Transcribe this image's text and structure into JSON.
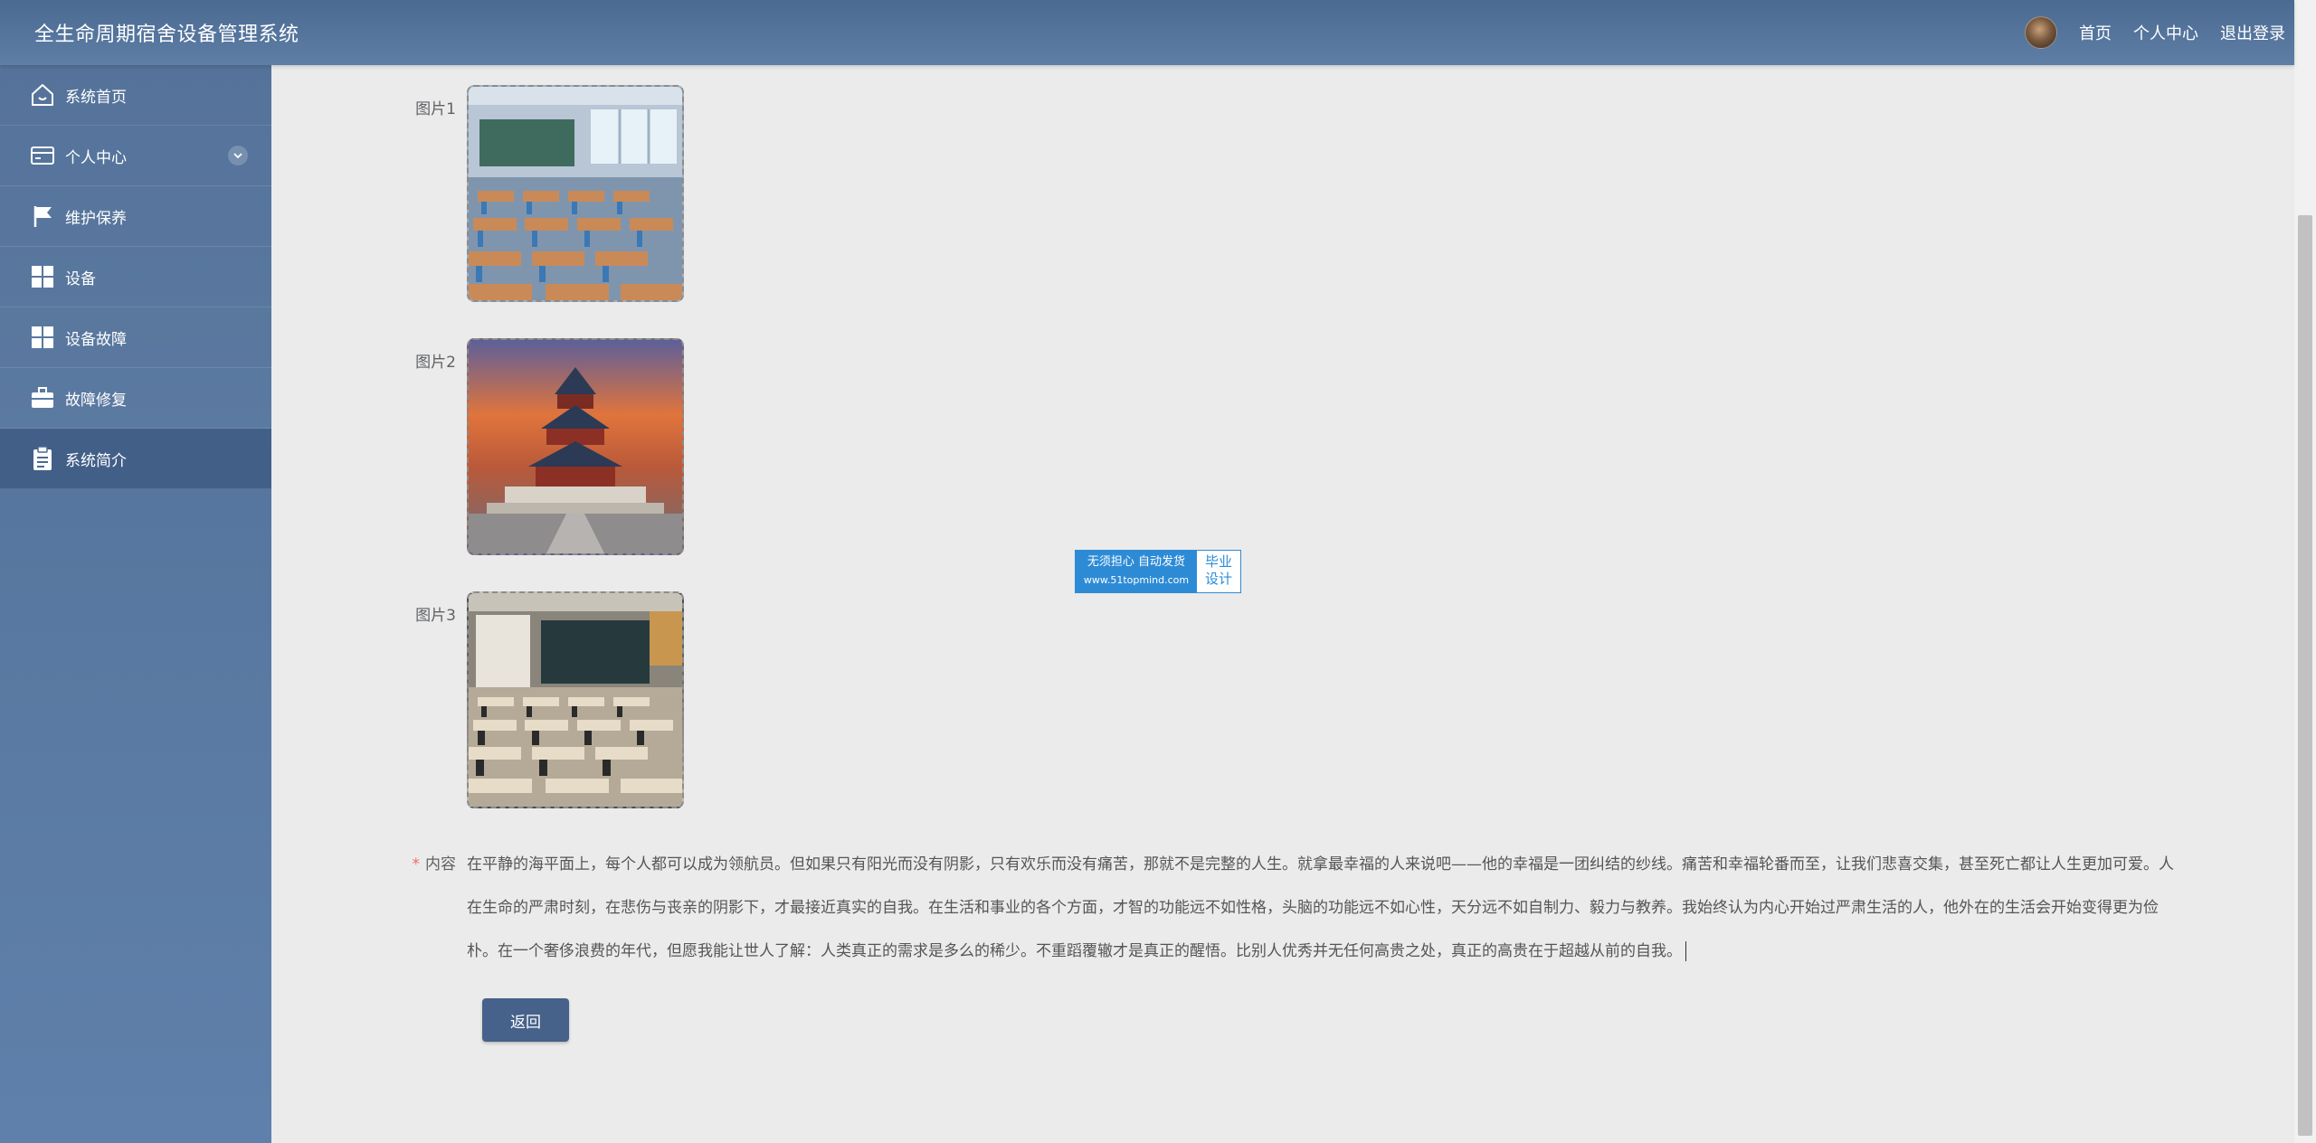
{
  "app": {
    "title": "全生命周期宿舍设备管理系统"
  },
  "header": {
    "links": {
      "home": "首页",
      "profile": "个人中心",
      "logout": "退出登录"
    }
  },
  "sidebar": {
    "items": [
      {
        "label": "系统首页",
        "icon": "home-icon"
      },
      {
        "label": "个人中心",
        "icon": "card-icon"
      },
      {
        "label": "维护保养",
        "icon": "flag-icon"
      },
      {
        "label": "设备",
        "icon": "grid-icon"
      },
      {
        "label": "设备故障",
        "icon": "grid-icon"
      },
      {
        "label": "故障修复",
        "icon": "briefcase-icon"
      },
      {
        "label": "系统简介",
        "icon": "clipboard-icon"
      }
    ]
  },
  "form": {
    "pic1_label": "图片1",
    "pic2_label": "图片2",
    "pic3_label": "图片3",
    "content_required": "*",
    "content_label": "内容",
    "content_text": "在平静的海平面上，每个人都可以成为领航员。但如果只有阳光而没有阴影，只有欢乐而没有痛苦，那就不是完整的人生。就拿最幸福的人来说吧——他的幸福是一团纠结的纱线。痛苦和幸福轮番而至，让我们悲喜交集，甚至死亡都让人生更加可爱。人在生命的严肃时刻，在悲伤与丧亲的阴影下，才最接近真实的自我。在生活和事业的各个方面，才智的功能远不如性格，头脑的功能远不如心性，天分远不如自制力、毅力与教养。我始终认为内心开始过严肃生活的人，他外在的生活会开始变得更为俭朴。在一个奢侈浪费的年代，但愿我能让世人了解：人类真正的需求是多么的稀少。不重蹈覆辙才是真正的醒悟。比别人优秀并无任何高贵之处，真正的高贵在于超越从前的自我。",
    "back_button": "返回"
  },
  "watermark": {
    "line1": "无须担心 自动发货",
    "line2": "www.51topmind.com",
    "right_line1": "毕业",
    "right_line2": "设计"
  }
}
